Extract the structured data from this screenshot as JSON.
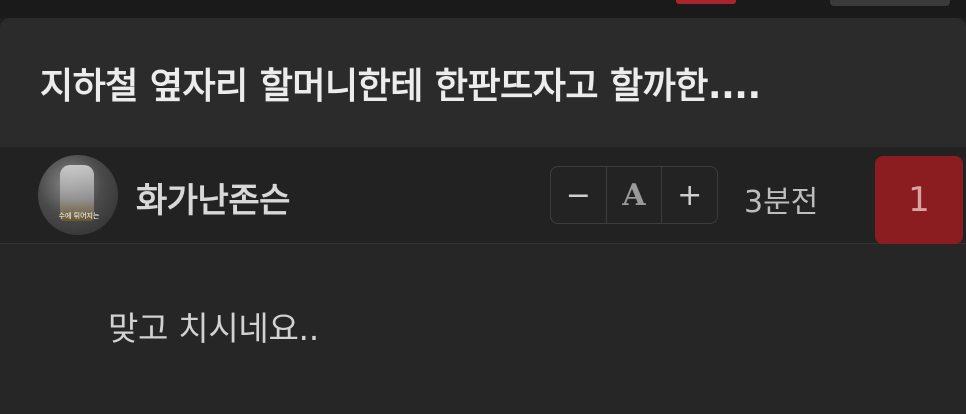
{
  "post": {
    "title": "지하철 옆자리 할머니한테 한판뜨자고 할까한....",
    "author": {
      "name": "화가난존슨",
      "avatar_caption": "수에 튀어지는"
    },
    "time": "3분전",
    "comment_count": "1",
    "body_text": "맞고 치시네요.."
  },
  "font_controls": {
    "decrease": "−",
    "font": "A",
    "increase": "+"
  },
  "colors": {
    "accent": "#8b1d21",
    "background": "#1f1f1f",
    "title_bar": "#2b2b2b"
  }
}
